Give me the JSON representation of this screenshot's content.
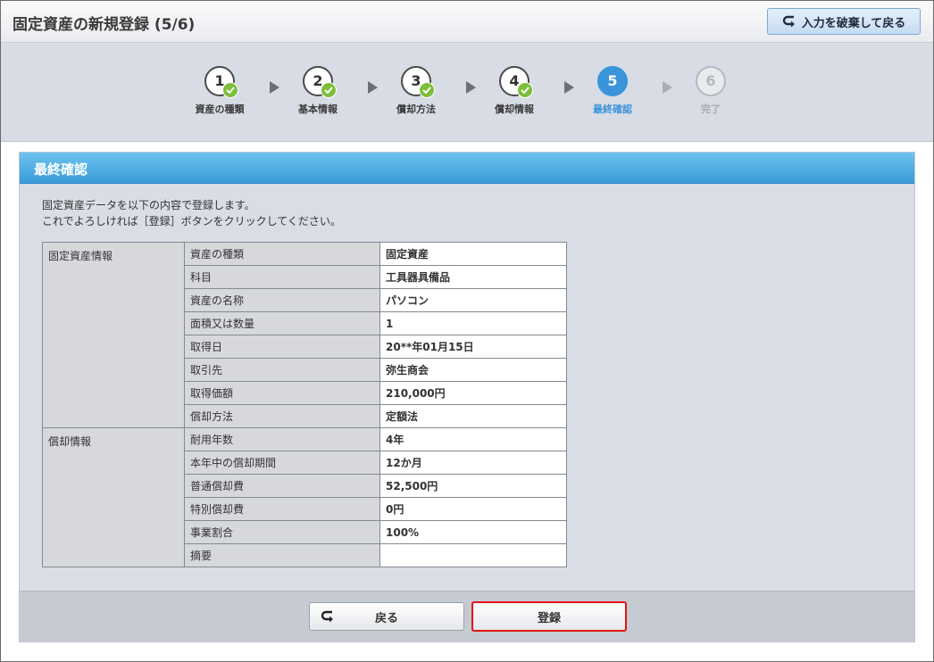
{
  "header": {
    "title": "固定資産の新規登録 (5/6)",
    "discard_label": "入力を破棄して戻る"
  },
  "steps": [
    {
      "num": "1",
      "label": "資産の種類",
      "state": "done"
    },
    {
      "num": "2",
      "label": "基本情報",
      "state": "done"
    },
    {
      "num": "3",
      "label": "償却方法",
      "state": "done"
    },
    {
      "num": "4",
      "label": "償却情報",
      "state": "done"
    },
    {
      "num": "5",
      "label": "最終確認",
      "state": "active"
    },
    {
      "num": "6",
      "label": "完了",
      "state": "future"
    }
  ],
  "panel": {
    "title": "最終確認",
    "intro_line1": "固定資産データを以下の内容で登録します。",
    "intro_line2": "これでよろしければ［登録］ボタンをクリックしてください。"
  },
  "table": {
    "group1": "固定資産情報",
    "group2": "償却情報",
    "rows": [
      {
        "key": "資産の種類",
        "value": "固定資産"
      },
      {
        "key": "科目",
        "value": "工具器具備品"
      },
      {
        "key": "資産の名称",
        "value": "パソコン"
      },
      {
        "key": "面積又は数量",
        "value": "1"
      },
      {
        "key": "取得日",
        "value": "20**年01月15日"
      },
      {
        "key": "取引先",
        "value": "弥生商会"
      },
      {
        "key": "取得価額",
        "value": "210,000円"
      },
      {
        "key": "償却方法",
        "value": "定額法"
      },
      {
        "key": "耐用年数",
        "value": "4年"
      },
      {
        "key": "本年中の償却期間",
        "value": "12か月"
      },
      {
        "key": "普通償却費",
        "value": "52,500円"
      },
      {
        "key": "特別償却費",
        "value": "0円"
      },
      {
        "key": "事業割合",
        "value": "100%"
      },
      {
        "key": "摘要",
        "value": ""
      }
    ]
  },
  "footer": {
    "back_label": "戻る",
    "register_label": "登録"
  },
  "colors": {
    "accent": "#3a94d9",
    "check": "#7cbf3b",
    "highlight": "#e11414"
  }
}
